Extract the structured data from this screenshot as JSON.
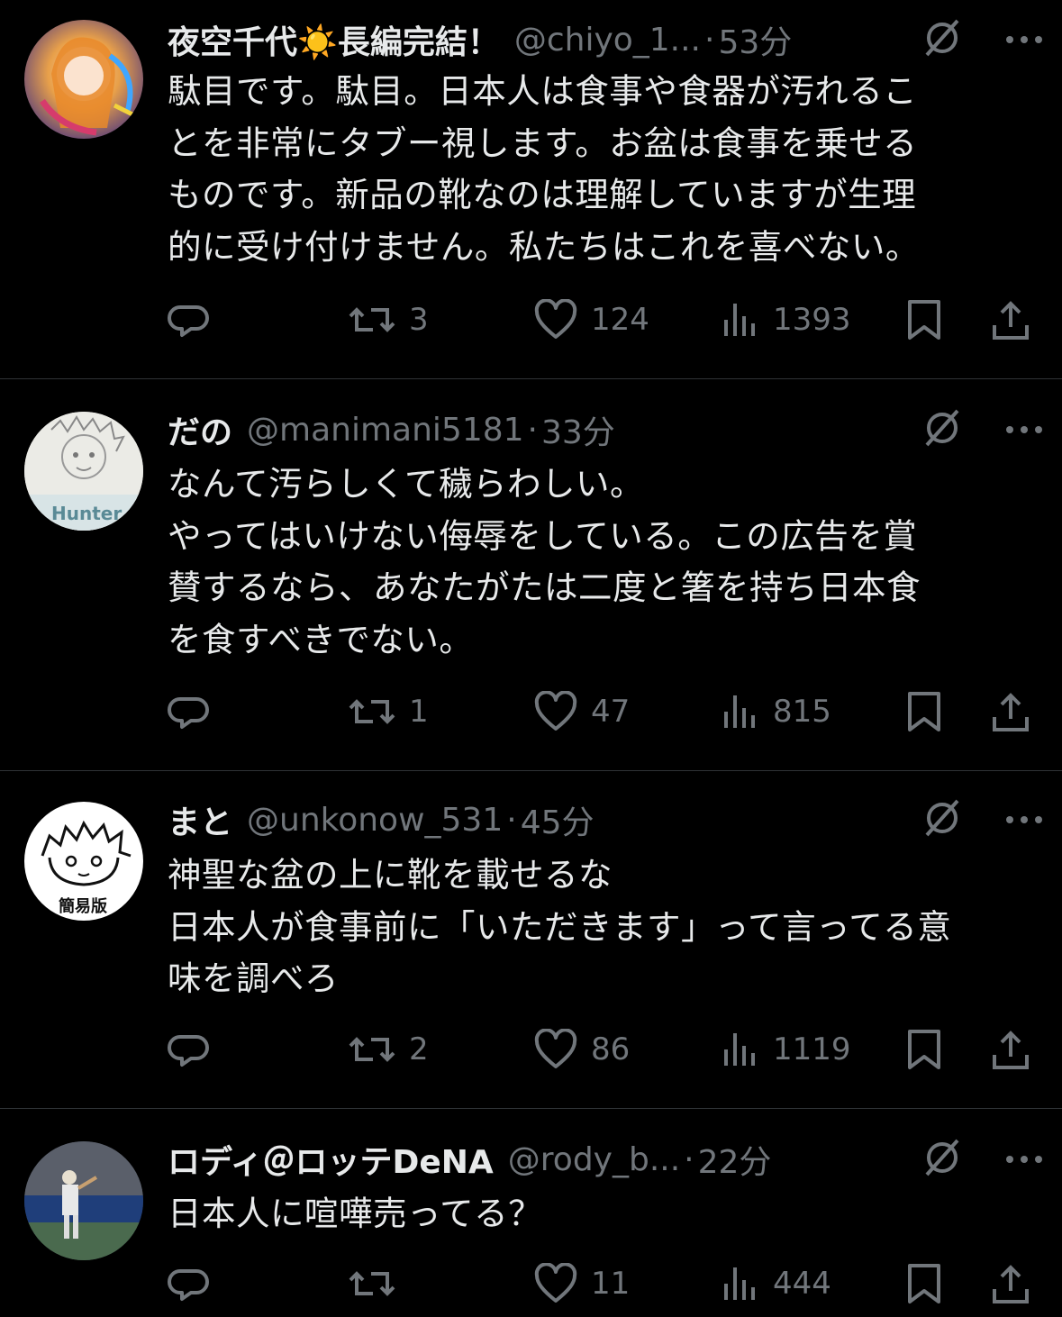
{
  "posts": [
    {
      "name": "夜空千代☀️長編完結！",
      "handle": "@chiyo_1...",
      "separator": "·",
      "time": "53分",
      "text": "駄目です。駄目。日本人は食事や食器が汚れるこ\nとを非常にタブー視します。お盆は食事を乗せる\nものです。新品の靴なのは理解していますが生理\n的に受け付けません。私たちはこれを喜べない。",
      "retweets": "3",
      "likes": "124",
      "views": "1393"
    },
    {
      "name": "だの",
      "handle": "@manimani5181",
      "separator": "·",
      "time": "33分",
      "text": "なんて汚らしくて穢らわしい。\nやってはいけない侮辱をしている。この広告を賞\n賛するなら、あなたがたは二度と箸を持ち日本食\nを食すべきでない。",
      "avatar_text": "Hunter",
      "retweets": "1",
      "likes": "47",
      "views": "815"
    },
    {
      "name": "まと",
      "handle": "@unkonow_531",
      "separator": "·",
      "time": "45分",
      "text": "神聖な盆の上に靴を載せるな\n日本人が食事前に「いただきます」って言ってる意\n味を調べろ",
      "avatar_text": "簡易版",
      "retweets": "2",
      "likes": "86",
      "views": "1119"
    },
    {
      "name": "ロディ＠ロッテDeNA",
      "handle": "@rody_b...",
      "separator": "·",
      "time": "22分",
      "text": "日本人に喧嘩売ってる？",
      "retweets": "",
      "likes": "11",
      "views": "444"
    }
  ],
  "icons": {
    "reply": "reply-icon",
    "retweet": "retweet-icon",
    "like": "heart-icon",
    "views": "views-icon",
    "bookmark": "bookmark-icon",
    "share": "share-icon",
    "grok": "grok-icon",
    "more": "more-icon"
  },
  "colors": {
    "background": "#000000",
    "text": "#e7e9ea",
    "muted": "#71767b",
    "divider": "#2f3336"
  }
}
